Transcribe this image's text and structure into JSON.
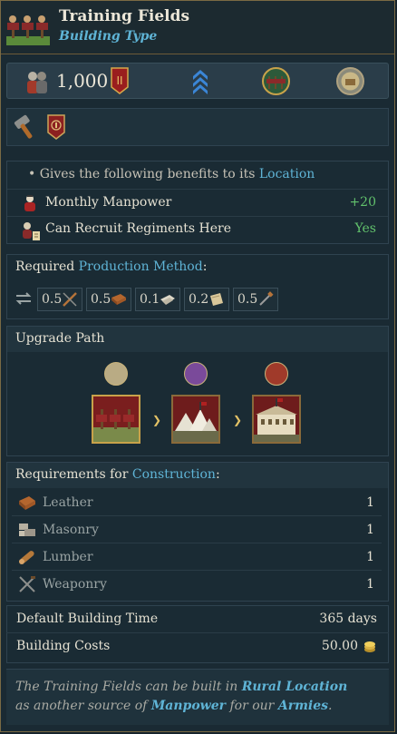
{
  "header": {
    "title": "Training Fields",
    "subtitle": "Building Type"
  },
  "stats": {
    "manpower_value": "1,000"
  },
  "benefits": {
    "intro_prefix": "• Gives the following benefits to its ",
    "intro_link": "Location",
    "rows": [
      {
        "label": "Monthly Manpower",
        "value": "+20",
        "icon": "manpower-soldier-icon"
      },
      {
        "label": "Can Recruit Regiments Here",
        "value": "Yes",
        "icon": "recruit-regiments-icon"
      }
    ]
  },
  "production": {
    "title_prefix": "Required ",
    "title_link": "Production Method",
    "title_suffix": ":",
    "items": [
      {
        "amount": "0.5",
        "icon": "weaponry-icon"
      },
      {
        "amount": "0.5",
        "icon": "leather-icon"
      },
      {
        "amount": "0.1",
        "icon": "paper-icon"
      },
      {
        "amount": "0.2",
        "icon": "cloth-icon"
      },
      {
        "amount": "0.5",
        "icon": "tools-icon"
      }
    ]
  },
  "upgrade": {
    "title": "Upgrade Path"
  },
  "requirements": {
    "title_prefix": "Requirements for ",
    "title_link": "Construction",
    "title_suffix": ":",
    "rows": [
      {
        "label": "Leather",
        "value": "1",
        "icon": "leather-icon"
      },
      {
        "label": "Masonry",
        "value": "1",
        "icon": "masonry-icon"
      },
      {
        "label": "Lumber",
        "value": "1",
        "icon": "lumber-icon"
      },
      {
        "label": "Weaponry",
        "value": "1",
        "icon": "weaponry-icon"
      }
    ]
  },
  "build": {
    "time_label": "Default Building Time",
    "time_value": "365 days",
    "cost_label": "Building Costs",
    "cost_value": "50.00"
  },
  "footer": {
    "p1": "The Training Fields can be built in ",
    "l1": "Rural Location",
    "p2": " as another source of ",
    "l2": "Manpower",
    "p3": " for our ",
    "l3": "Armies",
    "p4": "."
  },
  "colors": {
    "link": "#5fb4d6",
    "positive": "#62c26c",
    "gold": "#c8a24a"
  }
}
